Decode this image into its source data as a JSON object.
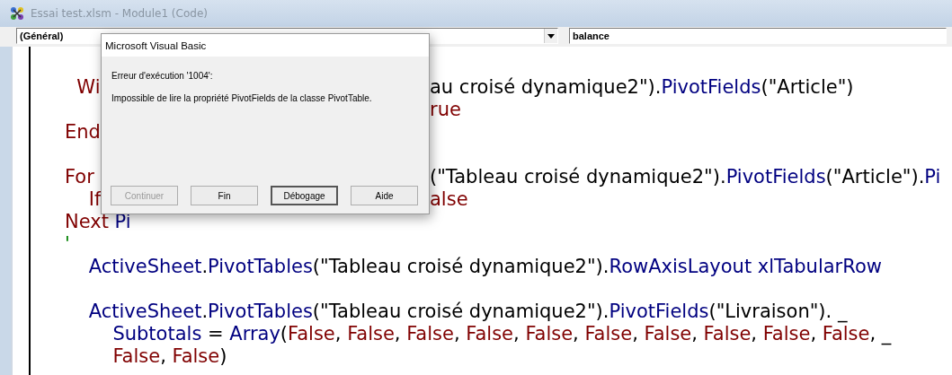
{
  "window": {
    "title": "Essai test.xlsm - Module1 (Code)"
  },
  "toolbar": {
    "object_combo": "(Général)",
    "procedure_combo": "balance"
  },
  "code_lines": [
    {
      "kind": "code",
      "left": [
        {
          "kind": "kw",
          "text": "  Wi"
        }
      ],
      "right": [
        {
          "kind": "tx",
          "text": "au croisé dynamique2\")."
        },
        {
          "kind": "id",
          "text": "PivotFields"
        },
        {
          "kind": "tx",
          "text": "(\"Article\")"
        }
      ]
    },
    {
      "kind": "code",
      "right": [
        {
          "kind": "kw",
          "text": "rue"
        }
      ]
    },
    {
      "kind": "code",
      "left": [
        {
          "kind": "kw",
          "text": "End"
        }
      ]
    },
    {
      "kind": "blank"
    },
    {
      "kind": "code",
      "left": [
        {
          "kind": "kw",
          "text": "For "
        }
      ],
      "right": [
        {
          "kind": "tx",
          "text": "(\"Tableau croisé dynamique2\")."
        },
        {
          "kind": "id",
          "text": "PivotFields"
        },
        {
          "kind": "tx",
          "text": "(\"Article\")."
        },
        {
          "kind": "id",
          "text": "Pi"
        }
      ]
    },
    {
      "kind": "code",
      "left": [
        {
          "kind": "kw",
          "text": "    If"
        }
      ],
      "right": [
        {
          "kind": "kw",
          "text": "alse"
        }
      ]
    },
    {
      "kind": "code",
      "left": [
        {
          "kind": "kw",
          "text": "Next "
        },
        {
          "kind": "id",
          "text": "Pi"
        }
      ]
    },
    {
      "kind": "code",
      "left": [
        {
          "kind": "cm",
          "text": "'"
        }
      ]
    },
    {
      "kind": "code",
      "left": [
        {
          "kind": "id",
          "text": "    ActiveSheet"
        },
        {
          "kind": "tx",
          "text": "."
        },
        {
          "kind": "id",
          "text": "PivotTables"
        },
        {
          "kind": "tx",
          "text": "(\"Tableau croisé dynamique2\")."
        },
        {
          "kind": "id",
          "text": "RowAxisLayout xlTabularRow"
        }
      ]
    },
    {
      "kind": "blank"
    },
    {
      "kind": "code",
      "left": [
        {
          "kind": "id",
          "text": "    ActiveSheet"
        },
        {
          "kind": "tx",
          "text": "."
        },
        {
          "kind": "id",
          "text": "PivotTables"
        },
        {
          "kind": "tx",
          "text": "(\"Tableau croisé dynamique2\")."
        },
        {
          "kind": "id",
          "text": "PivotFields"
        },
        {
          "kind": "tx",
          "text": "(\"Livraison\"). _"
        }
      ]
    },
    {
      "kind": "code",
      "left": [
        {
          "kind": "id",
          "text": "        Subtotals"
        },
        {
          "kind": "tx",
          "text": " = "
        },
        {
          "kind": "id",
          "text": "Array"
        },
        {
          "kind": "tx",
          "text": "("
        },
        {
          "kind": "kw",
          "text": "False"
        },
        {
          "kind": "tx",
          "text": ", "
        },
        {
          "kind": "kw",
          "text": "False"
        },
        {
          "kind": "tx",
          "text": ", "
        },
        {
          "kind": "kw",
          "text": "False"
        },
        {
          "kind": "tx",
          "text": ", "
        },
        {
          "kind": "kw",
          "text": "False"
        },
        {
          "kind": "tx",
          "text": ", "
        },
        {
          "kind": "kw",
          "text": "False"
        },
        {
          "kind": "tx",
          "text": ", "
        },
        {
          "kind": "kw",
          "text": "False"
        },
        {
          "kind": "tx",
          "text": ", "
        },
        {
          "kind": "kw",
          "text": "False"
        },
        {
          "kind": "tx",
          "text": ", "
        },
        {
          "kind": "kw",
          "text": "False"
        },
        {
          "kind": "tx",
          "text": ", "
        },
        {
          "kind": "kw",
          "text": "False"
        },
        {
          "kind": "tx",
          "text": ", "
        },
        {
          "kind": "kw",
          "text": "False"
        },
        {
          "kind": "tx",
          "text": ", _"
        }
      ]
    },
    {
      "kind": "code",
      "left": [
        {
          "kind": "kw",
          "text": "        False"
        },
        {
          "kind": "tx",
          "text": ", "
        },
        {
          "kind": "kw",
          "text": "False"
        },
        {
          "kind": "tx",
          "text": ")"
        }
      ]
    }
  ],
  "dialog": {
    "title": "Microsoft Visual Basic",
    "error": "Erreur d'exécution '1004':",
    "message": "Impossible de lire la propriété PivotFields de la classe PivotTable.",
    "buttons": [
      {
        "label": "Continuer",
        "disabled": true,
        "focused": false
      },
      {
        "label": "Fin",
        "disabled": false,
        "focused": false
      },
      {
        "label": "Débogage",
        "disabled": false,
        "focused": true
      },
      {
        "label": "Aide",
        "disabled": false,
        "focused": false
      }
    ]
  }
}
